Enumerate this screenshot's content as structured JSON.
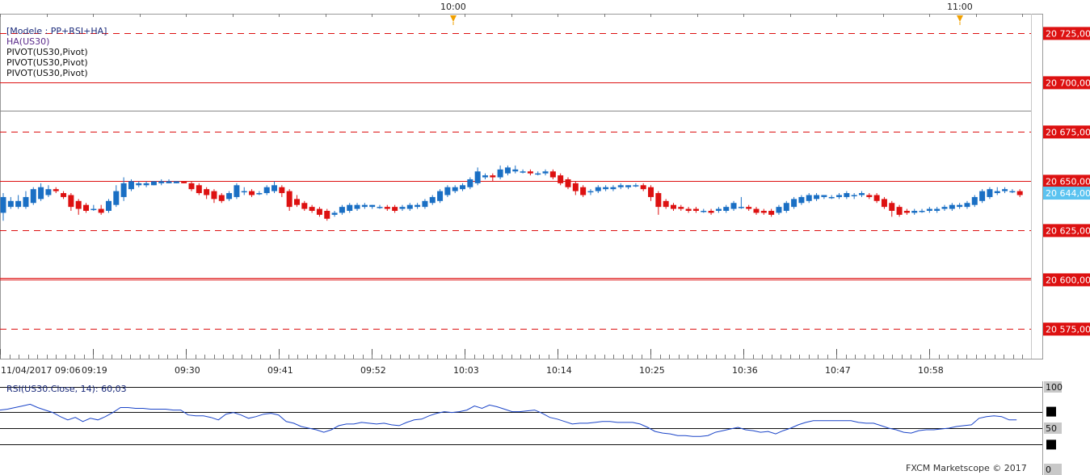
{
  "chart_data": [
    {
      "type": "candlestick",
      "title": "[Modele : PP+RSI+HA]",
      "indicators": [
        "HA(US30)",
        "PIVOT(US30,Pivot)",
        "PIVOT(US30,Pivot)",
        "PIVOT(US30,Pivot)"
      ],
      "ylim": [
        20560,
        20735
      ],
      "y_ticks": [
        "20 725,00",
        "20 700,00",
        "20 675,00",
        "20 650,00",
        "20 625,00",
        "20 600,00",
        "20 575,00"
      ],
      "last_price_label": "20 644,00",
      "last_price": 20644,
      "pivot_lines": [
        {
          "value": 20725,
          "style": "dashed"
        },
        {
          "value": 20700,
          "style": "solid"
        },
        {
          "value": 20686,
          "style": "gray"
        },
        {
          "value": 20675,
          "style": "dashed"
        },
        {
          "value": 20650,
          "style": "solid"
        },
        {
          "value": 20625,
          "style": "dashed"
        },
        {
          "value": 20601,
          "style": "solid"
        },
        {
          "value": 20600,
          "style": "solid"
        },
        {
          "value": 20575,
          "style": "dashed"
        }
      ],
      "x_ticks": [
        "11/04/2017 09:06",
        "09:19",
        "09:30",
        "09:41",
        "09:52",
        "10:03",
        "10:14",
        "10:25",
        "10:36",
        "10:47",
        "10:58"
      ],
      "session_markers": [
        "10:00",
        "11:00"
      ],
      "candles": [
        {
          "o": 20634,
          "c": 20642,
          "h": 20644,
          "l": 20630
        },
        {
          "o": 20637,
          "c": 20640,
          "h": 20642,
          "l": 20636
        },
        {
          "o": 20637,
          "c": 20640,
          "h": 20643,
          "l": 20636
        },
        {
          "o": 20637,
          "c": 20642,
          "h": 20645,
          "l": 20636
        },
        {
          "o": 20639,
          "c": 20646,
          "h": 20647,
          "l": 20638
        },
        {
          "o": 20641,
          "c": 20647,
          "h": 20649,
          "l": 20640
        },
        {
          "o": 20643,
          "c": 20646,
          "h": 20648,
          "l": 20642
        },
        {
          "o": 20646,
          "c": 20645,
          "h": 20647,
          "l": 20644
        },
        {
          "o": 20644,
          "c": 20642,
          "h": 20645,
          "l": 20641
        },
        {
          "o": 20643,
          "c": 20637,
          "h": 20644,
          "l": 20635
        },
        {
          "o": 20640,
          "c": 20636,
          "h": 20641,
          "l": 20633
        },
        {
          "o": 20638,
          "c": 20635,
          "h": 20639,
          "l": 20634
        },
        {
          "o": 20636,
          "c": 20636,
          "h": 20638,
          "l": 20635
        },
        {
          "o": 20636,
          "c": 20634,
          "h": 20638,
          "l": 20633
        },
        {
          "o": 20635,
          "c": 20640,
          "h": 20641,
          "l": 20634
        },
        {
          "o": 20638,
          "c": 20645,
          "h": 20648,
          "l": 20637
        },
        {
          "o": 20642,
          "c": 20649,
          "h": 20652,
          "l": 20640
        },
        {
          "o": 20646,
          "c": 20650,
          "h": 20651,
          "l": 20645
        },
        {
          "o": 20648,
          "c": 20649,
          "h": 20650,
          "l": 20647
        },
        {
          "o": 20648,
          "c": 20649,
          "h": 20650,
          "l": 20647
        },
        {
          "o": 20648,
          "c": 20650,
          "h": 20650,
          "l": 20648
        },
        {
          "o": 20649,
          "c": 20650,
          "h": 20651,
          "l": 20648
        },
        {
          "o": 20649,
          "c": 20650,
          "h": 20651,
          "l": 20649
        },
        {
          "o": 20649,
          "c": 20650,
          "h": 20650,
          "l": 20649
        },
        {
          "o": 20650,
          "c": 20649,
          "h": 20650,
          "l": 20649
        },
        {
          "o": 20649,
          "c": 20646,
          "h": 20650,
          "l": 20645
        },
        {
          "o": 20648,
          "c": 20644,
          "h": 20649,
          "l": 20643
        },
        {
          "o": 20646,
          "c": 20643,
          "h": 20647,
          "l": 20641
        },
        {
          "o": 20645,
          "c": 20641,
          "h": 20646,
          "l": 20639
        },
        {
          "o": 20643,
          "c": 20640,
          "h": 20644,
          "l": 20639
        },
        {
          "o": 20641,
          "c": 20644,
          "h": 20645,
          "l": 20640
        },
        {
          "o": 20642,
          "c": 20648,
          "h": 20649,
          "l": 20641
        },
        {
          "o": 20645,
          "c": 20645,
          "h": 20647,
          "l": 20643
        },
        {
          "o": 20645,
          "c": 20643,
          "h": 20646,
          "l": 20642
        },
        {
          "o": 20644,
          "c": 20644,
          "h": 20645,
          "l": 20643
        },
        {
          "o": 20644,
          "c": 20647,
          "h": 20648,
          "l": 20643
        },
        {
          "o": 20645,
          "c": 20648,
          "h": 20650,
          "l": 20644
        },
        {
          "o": 20647,
          "c": 20644,
          "h": 20648,
          "l": 20642
        },
        {
          "o": 20645,
          "c": 20637,
          "h": 20646,
          "l": 20635
        },
        {
          "o": 20641,
          "c": 20638,
          "h": 20643,
          "l": 20637
        },
        {
          "o": 20639,
          "c": 20636,
          "h": 20640,
          "l": 20635
        },
        {
          "o": 20637,
          "c": 20635,
          "h": 20638,
          "l": 20634
        },
        {
          "o": 20636,
          "c": 20633,
          "h": 20637,
          "l": 20632
        },
        {
          "o": 20635,
          "c": 20631,
          "h": 20636,
          "l": 20630
        },
        {
          "o": 20633,
          "c": 20634,
          "h": 20635,
          "l": 20632
        },
        {
          "o": 20634,
          "c": 20637,
          "h": 20638,
          "l": 20633
        },
        {
          "o": 20635,
          "c": 20638,
          "h": 20639,
          "l": 20634
        },
        {
          "o": 20636,
          "c": 20638,
          "h": 20639,
          "l": 20635
        },
        {
          "o": 20637,
          "c": 20638,
          "h": 20639,
          "l": 20636
        },
        {
          "o": 20637,
          "c": 20638,
          "h": 20638,
          "l": 20636
        },
        {
          "o": 20637,
          "c": 20637,
          "h": 20638,
          "l": 20636
        },
        {
          "o": 20637,
          "c": 20636,
          "h": 20638,
          "l": 20635
        },
        {
          "o": 20637,
          "c": 20635,
          "h": 20638,
          "l": 20634
        },
        {
          "o": 20636,
          "c": 20637,
          "h": 20638,
          "l": 20635
        },
        {
          "o": 20636,
          "c": 20638,
          "h": 20639,
          "l": 20635
        },
        {
          "o": 20637,
          "c": 20638,
          "h": 20639,
          "l": 20636
        },
        {
          "o": 20637,
          "c": 20640,
          "h": 20641,
          "l": 20636
        },
        {
          "o": 20639,
          "c": 20642,
          "h": 20643,
          "l": 20638
        },
        {
          "o": 20640,
          "c": 20645,
          "h": 20646,
          "l": 20639
        },
        {
          "o": 20643,
          "c": 20647,
          "h": 20648,
          "l": 20642
        },
        {
          "o": 20645,
          "c": 20647,
          "h": 20648,
          "l": 20644
        },
        {
          "o": 20646,
          "c": 20648,
          "h": 20649,
          "l": 20645
        },
        {
          "o": 20647,
          "c": 20651,
          "h": 20652,
          "l": 20646
        },
        {
          "o": 20649,
          "c": 20655,
          "h": 20657,
          "l": 20648
        },
        {
          "o": 20652,
          "c": 20653,
          "h": 20654,
          "l": 20651
        },
        {
          "o": 20653,
          "c": 20652,
          "h": 20654,
          "l": 20650
        },
        {
          "o": 20652,
          "c": 20656,
          "h": 20658,
          "l": 20651
        },
        {
          "o": 20654,
          "c": 20657,
          "h": 20658,
          "l": 20653
        },
        {
          "o": 20655,
          "c": 20656,
          "h": 20658,
          "l": 20654
        },
        {
          "o": 20655,
          "c": 20655,
          "h": 20656,
          "l": 20654
        },
        {
          "o": 20655,
          "c": 20654,
          "h": 20656,
          "l": 20653
        },
        {
          "o": 20654,
          "c": 20654,
          "h": 20655,
          "l": 20653
        },
        {
          "o": 20654,
          "c": 20655,
          "h": 20656,
          "l": 20653
        },
        {
          "o": 20655,
          "c": 20652,
          "h": 20656,
          "l": 20651
        },
        {
          "o": 20653,
          "c": 20649,
          "h": 20654,
          "l": 20648
        },
        {
          "o": 20651,
          "c": 20647,
          "h": 20652,
          "l": 20646
        },
        {
          "o": 20649,
          "c": 20645,
          "h": 20650,
          "l": 20643
        },
        {
          "o": 20647,
          "c": 20643,
          "h": 20648,
          "l": 20642
        },
        {
          "o": 20645,
          "c": 20645,
          "h": 20646,
          "l": 20643
        },
        {
          "o": 20645,
          "c": 20647,
          "h": 20648,
          "l": 20644
        },
        {
          "o": 20646,
          "c": 20647,
          "h": 20648,
          "l": 20645
        },
        {
          "o": 20646,
          "c": 20647,
          "h": 20648,
          "l": 20645
        },
        {
          "o": 20647,
          "c": 20648,
          "h": 20649,
          "l": 20646
        },
        {
          "o": 20647,
          "c": 20648,
          "h": 20648,
          "l": 20646
        },
        {
          "o": 20648,
          "c": 20648,
          "h": 20649,
          "l": 20647
        },
        {
          "o": 20648,
          "c": 20646,
          "h": 20649,
          "l": 20645
        },
        {
          "o": 20647,
          "c": 20642,
          "h": 20648,
          "l": 20640
        },
        {
          "o": 20644,
          "c": 20637,
          "h": 20645,
          "l": 20633
        },
        {
          "o": 20640,
          "c": 20637,
          "h": 20641,
          "l": 20636
        },
        {
          "o": 20638,
          "c": 20636,
          "h": 20639,
          "l": 20635
        },
        {
          "o": 20637,
          "c": 20636,
          "h": 20638,
          "l": 20635
        },
        {
          "o": 20636,
          "c": 20635,
          "h": 20637,
          "l": 20634
        },
        {
          "o": 20636,
          "c": 20635,
          "h": 20637,
          "l": 20634
        },
        {
          "o": 20635,
          "c": 20635,
          "h": 20636,
          "l": 20634
        },
        {
          "o": 20635,
          "c": 20634,
          "h": 20636,
          "l": 20633
        },
        {
          "o": 20635,
          "c": 20636,
          "h": 20637,
          "l": 20634
        },
        {
          "o": 20635,
          "c": 20637,
          "h": 20638,
          "l": 20634
        },
        {
          "o": 20636,
          "c": 20639,
          "h": 20640,
          "l": 20635
        },
        {
          "o": 20637,
          "c": 20637,
          "h": 20642,
          "l": 20636
        },
        {
          "o": 20637,
          "c": 20636,
          "h": 20638,
          "l": 20635
        },
        {
          "o": 20636,
          "c": 20634,
          "h": 20637,
          "l": 20633
        },
        {
          "o": 20635,
          "c": 20634,
          "h": 20636,
          "l": 20633
        },
        {
          "o": 20635,
          "c": 20633,
          "h": 20636,
          "l": 20632
        },
        {
          "o": 20634,
          "c": 20637,
          "h": 20638,
          "l": 20633
        },
        {
          "o": 20635,
          "c": 20639,
          "h": 20640,
          "l": 20634
        },
        {
          "o": 20637,
          "c": 20641,
          "h": 20642,
          "l": 20636
        },
        {
          "o": 20639,
          "c": 20642,
          "h": 20643,
          "l": 20638
        },
        {
          "o": 20640,
          "c": 20643,
          "h": 20644,
          "l": 20639
        },
        {
          "o": 20641,
          "c": 20643,
          "h": 20644,
          "l": 20640
        },
        {
          "o": 20642,
          "c": 20643,
          "h": 20643,
          "l": 20641
        },
        {
          "o": 20642,
          "c": 20642,
          "h": 20643,
          "l": 20641
        },
        {
          "o": 20642,
          "c": 20643,
          "h": 20644,
          "l": 20641
        },
        {
          "o": 20642,
          "c": 20644,
          "h": 20645,
          "l": 20641
        },
        {
          "o": 20643,
          "c": 20643,
          "h": 20644,
          "l": 20641
        },
        {
          "o": 20643,
          "c": 20644,
          "h": 20645,
          "l": 20642
        },
        {
          "o": 20643,
          "c": 20642,
          "h": 20644,
          "l": 20641
        },
        {
          "o": 20643,
          "c": 20640,
          "h": 20644,
          "l": 20639
        },
        {
          "o": 20641,
          "c": 20637,
          "h": 20642,
          "l": 20636
        },
        {
          "o": 20639,
          "c": 20635,
          "h": 20640,
          "l": 20632
        },
        {
          "o": 20637,
          "c": 20633,
          "h": 20638,
          "l": 20632
        },
        {
          "o": 20635,
          "c": 20634,
          "h": 20636,
          "l": 20633
        },
        {
          "o": 20634,
          "c": 20635,
          "h": 20636,
          "l": 20633
        },
        {
          "o": 20635,
          "c": 20635,
          "h": 20636,
          "l": 20634
        },
        {
          "o": 20635,
          "c": 20636,
          "h": 20637,
          "l": 20634
        },
        {
          "o": 20635,
          "c": 20636,
          "h": 20637,
          "l": 20634
        },
        {
          "o": 20636,
          "c": 20637,
          "h": 20638,
          "l": 20635
        },
        {
          "o": 20636,
          "c": 20638,
          "h": 20639,
          "l": 20635
        },
        {
          "o": 20637,
          "c": 20638,
          "h": 20639,
          "l": 20636
        },
        {
          "o": 20637,
          "c": 20639,
          "h": 20640,
          "l": 20636
        },
        {
          "o": 20638,
          "c": 20642,
          "h": 20643,
          "l": 20637
        },
        {
          "o": 20640,
          "c": 20645,
          "h": 20646,
          "l": 20639
        },
        {
          "o": 20642,
          "c": 20646,
          "h": 20647,
          "l": 20641
        },
        {
          "o": 20644,
          "c": 20645,
          "h": 20647,
          "l": 20643
        },
        {
          "o": 20645,
          "c": 20646,
          "h": 20647,
          "l": 20644
        },
        {
          "o": 20645,
          "c": 20645,
          "h": 20646,
          "l": 20644
        },
        {
          "o": 20645,
          "c": 20643,
          "h": 20646,
          "l": 20642
        }
      ]
    },
    {
      "type": "line",
      "title": "RSI(US30.Close, 14): 60,03",
      "ylim": [
        0,
        100
      ],
      "y_ticks": [
        "100",
        "50",
        "0"
      ],
      "levels": [
        70,
        50,
        30
      ],
      "values": [
        72,
        73,
        75,
        77,
        79,
        75,
        72,
        69,
        64,
        60,
        63,
        58,
        62,
        60,
        64,
        69,
        75,
        75,
        74,
        74,
        73,
        73,
        73,
        72,
        72,
        66,
        65,
        65,
        63,
        60,
        67,
        69,
        66,
        62,
        64,
        67,
        68,
        66,
        58,
        56,
        52,
        50,
        48,
        45,
        48,
        53,
        55,
        55,
        57,
        56,
        55,
        56,
        54,
        53,
        57,
        60,
        61,
        65,
        68,
        70,
        69,
        70,
        72,
        77,
        74,
        78,
        76,
        73,
        70,
        70,
        71,
        72,
        68,
        63,
        61,
        58,
        55,
        56,
        56,
        57,
        58,
        58,
        57,
        57,
        57,
        55,
        51,
        46,
        44,
        43,
        41,
        41,
        40,
        40,
        41,
        45,
        47,
        49,
        51,
        48,
        47,
        45,
        46,
        43,
        47,
        50,
        54,
        57,
        59,
        59,
        59,
        59,
        59,
        59,
        57,
        56,
        56,
        53,
        50,
        48,
        45,
        44,
        47,
        48,
        48,
        49,
        50,
        52,
        53,
        54,
        62,
        64,
        65,
        64,
        60,
        60
      ],
      "bottom_label": "FXCM Marketscope © 2017"
    }
  ],
  "colors": {
    "bull": "#1a6fc4",
    "bear": "#dd1111",
    "pivot": "#dd1111",
    "rsi_line": "#1a44c8",
    "last_price_bg": "#5bc3f0",
    "marker": "#f0a000"
  }
}
